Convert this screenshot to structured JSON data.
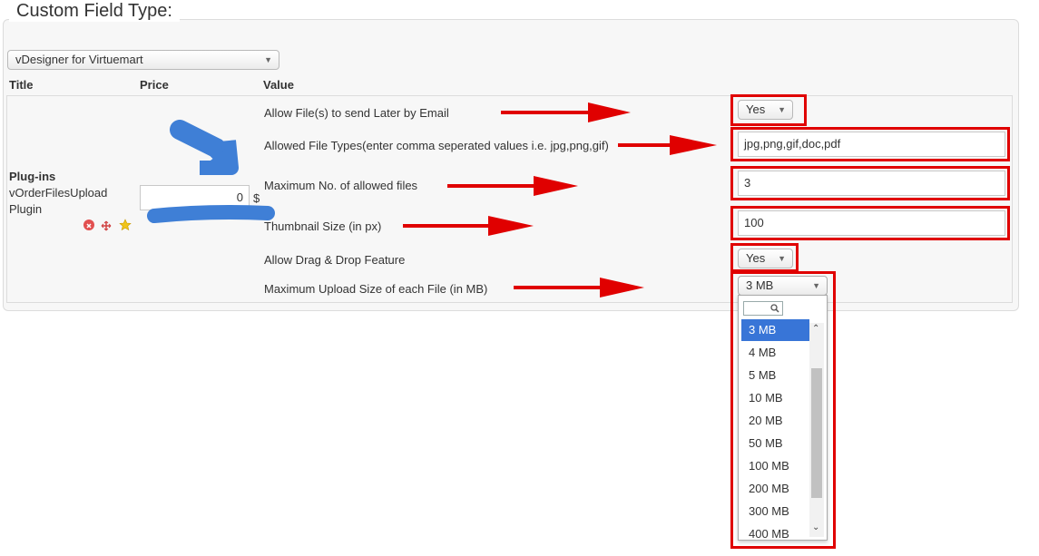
{
  "legend": "Custom Field Type:",
  "type_select": {
    "value": "vDesigner for Virtuemart"
  },
  "columns": {
    "title": "Title",
    "price": "Price",
    "value": "Value"
  },
  "row": {
    "group": "Plug-ins",
    "plugin_name_line1": "vOrderFilesUpload",
    "plugin_name_line2": "Plugin",
    "price_value": "0",
    "currency": "$"
  },
  "settings": {
    "allow_send_later_label": "Allow File(s) to send Later by Email",
    "allow_send_later_value": "Yes",
    "allowed_types_label": "Allowed File Types(enter comma seperated values i.e. jpg,png,gif)",
    "allowed_types_value": "jpg,png,gif,doc,pdf",
    "max_files_label": "Maximum No. of allowed files",
    "max_files_value": "3",
    "thumb_size_label": "Thumbnail Size (in px)",
    "thumb_size_value": "100",
    "drag_drop_label": "Allow Drag & Drop Feature",
    "drag_drop_value": "Yes",
    "max_upload_label": "Maximum Upload Size of each File (in MB)",
    "max_upload_value": "3 MB"
  },
  "dropdown_options": [
    "3 MB",
    "4 MB",
    "5 MB",
    "10 MB",
    "20 MB",
    "50 MB",
    "100 MB",
    "200 MB",
    "300 MB",
    "400 MB"
  ],
  "colors": {
    "annotation_red": "#e00000",
    "highlight_blue": "#3875d7",
    "marker_blue": "#3f7fd6"
  }
}
